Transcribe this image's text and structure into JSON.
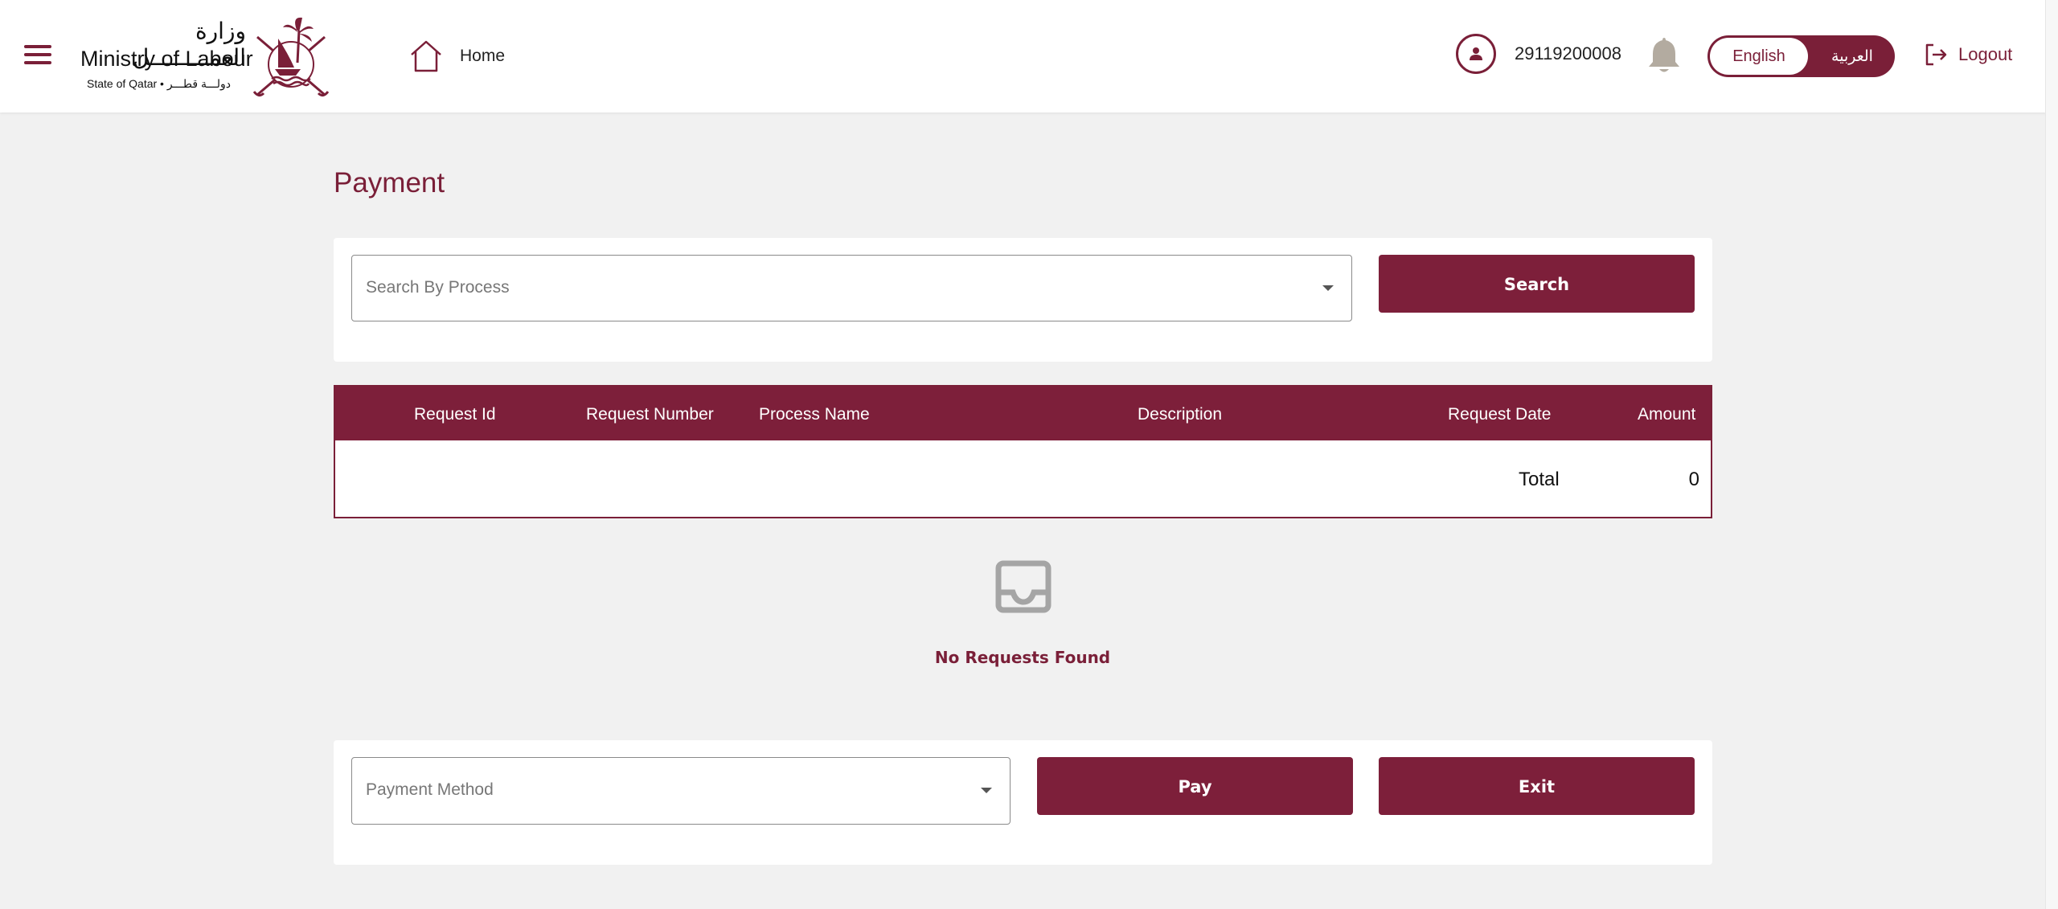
{
  "header": {
    "logo": {
      "arabic_name": "وزارة العمـــــــــل",
      "english_name": "Ministry of Labour",
      "subtitle": "State of Qatar • دولـــة قطـــر"
    },
    "home_label": "Home",
    "user_id": "29119200008",
    "language": {
      "english_label": "English",
      "arabic_label": "العربية",
      "active": "English"
    },
    "logout_label": "Logout"
  },
  "page": {
    "title": "Payment"
  },
  "search": {
    "process_placeholder": "Search By Process",
    "button_label": "Search"
  },
  "table": {
    "columns": [
      "Request Id",
      "Request Number",
      "Process Name",
      "Description",
      "Request Date",
      "Amount"
    ],
    "rows": [],
    "total_label": "Total",
    "total_value": "0"
  },
  "empty_state": {
    "message": "No Requests Found"
  },
  "payment": {
    "method_placeholder": "Payment Method",
    "pay_label": "Pay",
    "exit_label": "Exit"
  },
  "colors": {
    "brand": "#7d1f3a",
    "background": "#f1f1f1",
    "bell": "#b3aba0"
  },
  "icons": [
    "menu-icon",
    "home-icon",
    "user-icon",
    "bell-icon",
    "logout-icon",
    "inbox-icon",
    "chevron-down-icon"
  ]
}
